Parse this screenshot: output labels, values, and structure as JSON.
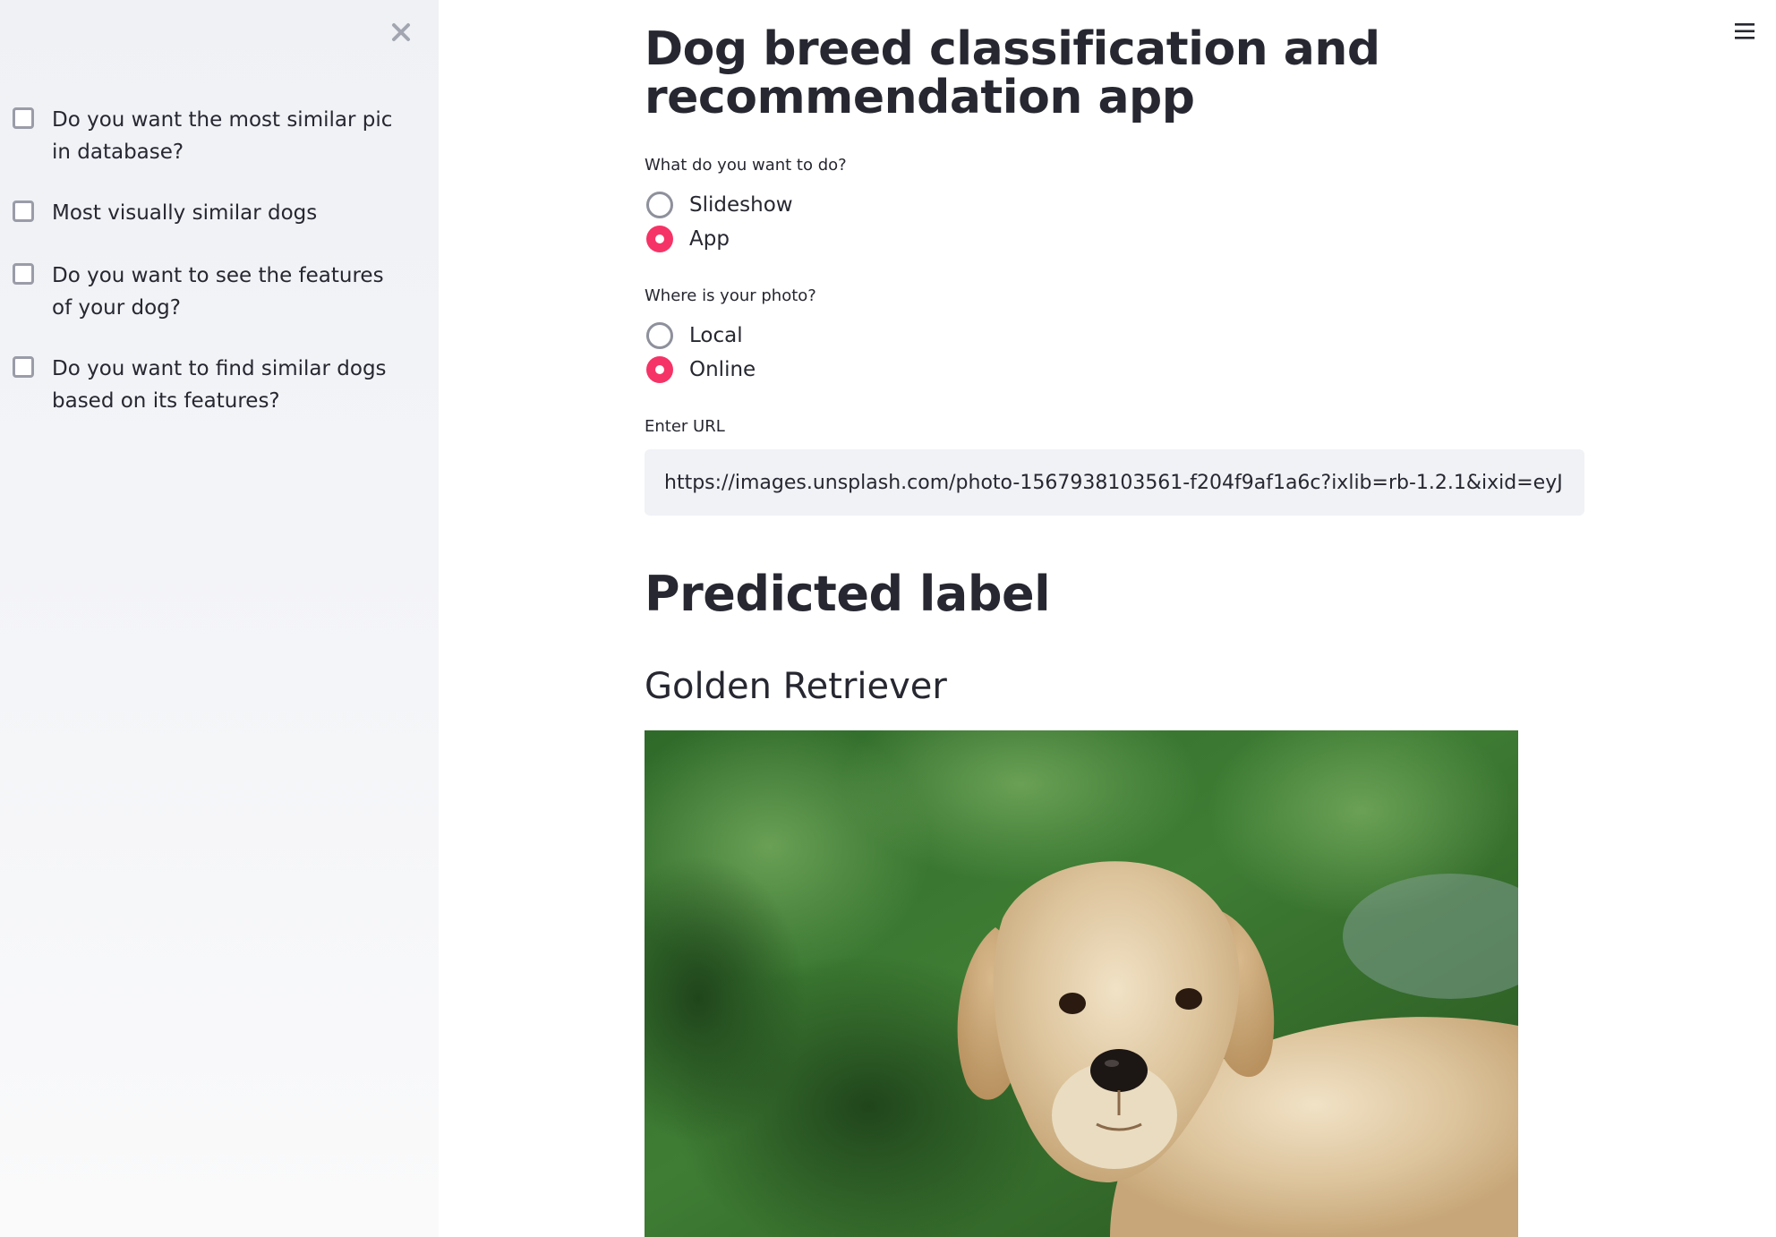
{
  "sidebar": {
    "checkboxes": [
      {
        "label": "Do you want the most similar pic in database?",
        "checked": false
      },
      {
        "label": "Most visually similar dogs",
        "checked": false
      },
      {
        "label": "Do you want to see the features of your dog?",
        "checked": false
      },
      {
        "label": "Do you want to find similar dogs based on its features?",
        "checked": false
      }
    ]
  },
  "main": {
    "title": "Dog breed classification and recommendation app",
    "mode": {
      "label": "What do you want to do?",
      "options": [
        "Slideshow",
        "App"
      ],
      "selected": "App"
    },
    "photo_source": {
      "label": "Where is your photo?",
      "options": [
        "Local",
        "Online"
      ],
      "selected": "Online"
    },
    "url": {
      "label": "Enter URL",
      "value": "https://images.unsplash.com/photo-1567938103561-f204f9af1a6c?ixlib=rb-1.2.1&ixid=eyJ"
    },
    "predicted_heading": "Predicted label",
    "predicted_label": "Golden Retriever"
  },
  "colors": {
    "accent": "#f63366",
    "sidebar_bg": "#f0f2f6",
    "text": "#262730"
  },
  "icons": {
    "close": "close-icon",
    "menu": "hamburger-menu-icon"
  }
}
